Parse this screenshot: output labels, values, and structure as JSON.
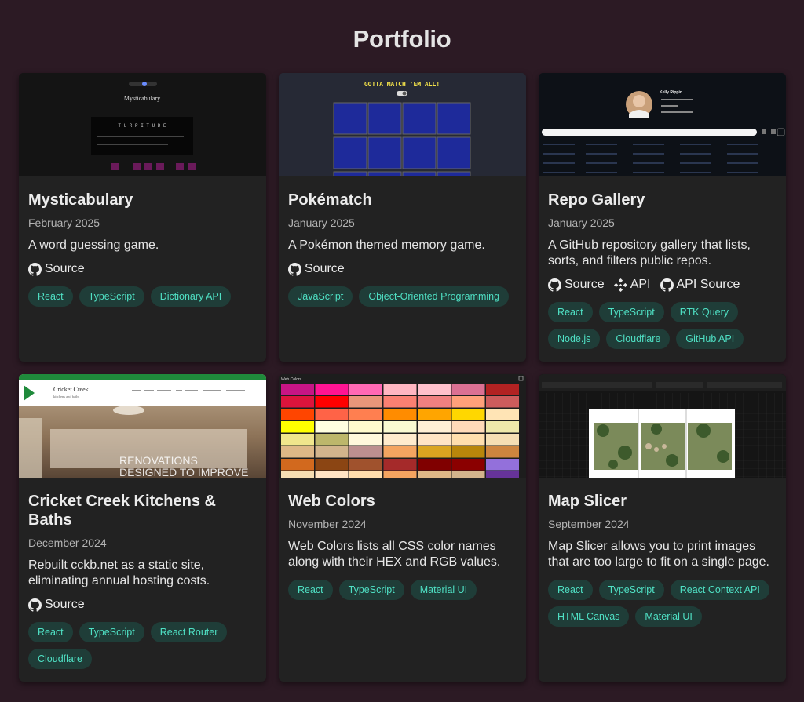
{
  "page": {
    "title": "Portfolio"
  },
  "colors": {
    "background": "#2c1a24",
    "card": "#222222",
    "tag_bg": "#1f3d38",
    "tag_text": "#4fe0c4"
  },
  "projects": [
    {
      "title": "Mysticabulary",
      "date": "February 2025",
      "description": "A word guessing game.",
      "links": [
        {
          "label": "Source",
          "icon": "github-icon"
        }
      ],
      "tags": [
        "React",
        "TypeScript",
        "Dictionary API"
      ],
      "thumbnail": {
        "heading": "Mysticabulary",
        "word": "T U R P I T U D E"
      }
    },
    {
      "title": "Pokématch",
      "date": "January 2025",
      "description": "A Pokémon themed memory game.",
      "links": [
        {
          "label": "Source",
          "icon": "github-icon"
        }
      ],
      "tags": [
        "JavaScript",
        "Object-Oriented Programming"
      ],
      "thumbnail": {
        "heading": "GOTTA MATCH 'EM ALL!"
      }
    },
    {
      "title": "Repo Gallery",
      "date": "January 2025",
      "description": "A GitHub repository gallery that lists, sorts, and filters public repos.",
      "links": [
        {
          "label": "Source",
          "icon": "github-icon"
        },
        {
          "label": "API",
          "icon": "api-icon"
        },
        {
          "label": "API Source",
          "icon": "github-icon"
        }
      ],
      "tags": [
        "React",
        "TypeScript",
        "RTK Query",
        "Node.js",
        "Cloudflare",
        "GitHub API"
      ],
      "thumbnail": {
        "name": "Kelly Rippin"
      }
    },
    {
      "title": "Cricket Creek Kitchens & Baths",
      "date": "December 2024",
      "description": "Rebuilt cckb.net as a static site, eliminating annual hosting costs.",
      "links": [
        {
          "label": "Source",
          "icon": "github-icon"
        }
      ],
      "tags": [
        "React",
        "TypeScript",
        "React Router",
        "Cloudflare"
      ],
      "thumbnail": {
        "logo": "Cricket Creek",
        "logo_sub": "kitchens and baths",
        "overlay1": "RENOVATIONS",
        "overlay2": "DESIGNED TO IMPROVE"
      }
    },
    {
      "title": "Web Colors",
      "date": "November 2024",
      "description": "Web Colors lists all CSS color names along with their HEX and RGB values.",
      "links": [],
      "tags": [
        "React",
        "TypeScript",
        "Material UI"
      ],
      "thumbnail": {
        "heading": "Web Colors"
      }
    },
    {
      "title": "Map Slicer",
      "date": "September 2024",
      "description": "Map Slicer allows you to print images that are too large to fit on a single page.",
      "links": [],
      "tags": [
        "React",
        "TypeScript",
        "React Context API",
        "HTML Canvas",
        "Material UI"
      ],
      "thumbnail": {}
    }
  ]
}
